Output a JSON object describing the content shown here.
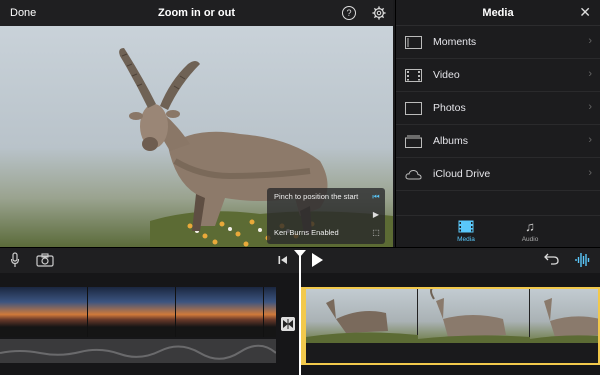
{
  "toolbar": {
    "done_label": "Done",
    "title": "Zoom in or out",
    "help_glyph": "?"
  },
  "viewer": {
    "hint_pinch": "Pinch to position the start",
    "hint_ken_burns": "Ken Burns Enabled"
  },
  "media": {
    "title": "Media",
    "close_glyph": "✕",
    "items": [
      {
        "label": "Moments",
        "icon": "moments-icon"
      },
      {
        "label": "Video",
        "icon": "video-icon"
      },
      {
        "label": "Photos",
        "icon": "photos-icon"
      },
      {
        "label": "Albums",
        "icon": "albums-icon"
      },
      {
        "label": "iCloud Drive",
        "icon": "icloud-icon"
      }
    ],
    "tabs": [
      {
        "label": "Media",
        "active": true
      },
      {
        "label": "Audio",
        "active": false
      }
    ],
    "chevron": "›"
  },
  "colors": {
    "accent": "#5ac8fa",
    "clip_selected": "#f2c94c",
    "panel_bg": "#1c1c1e"
  }
}
